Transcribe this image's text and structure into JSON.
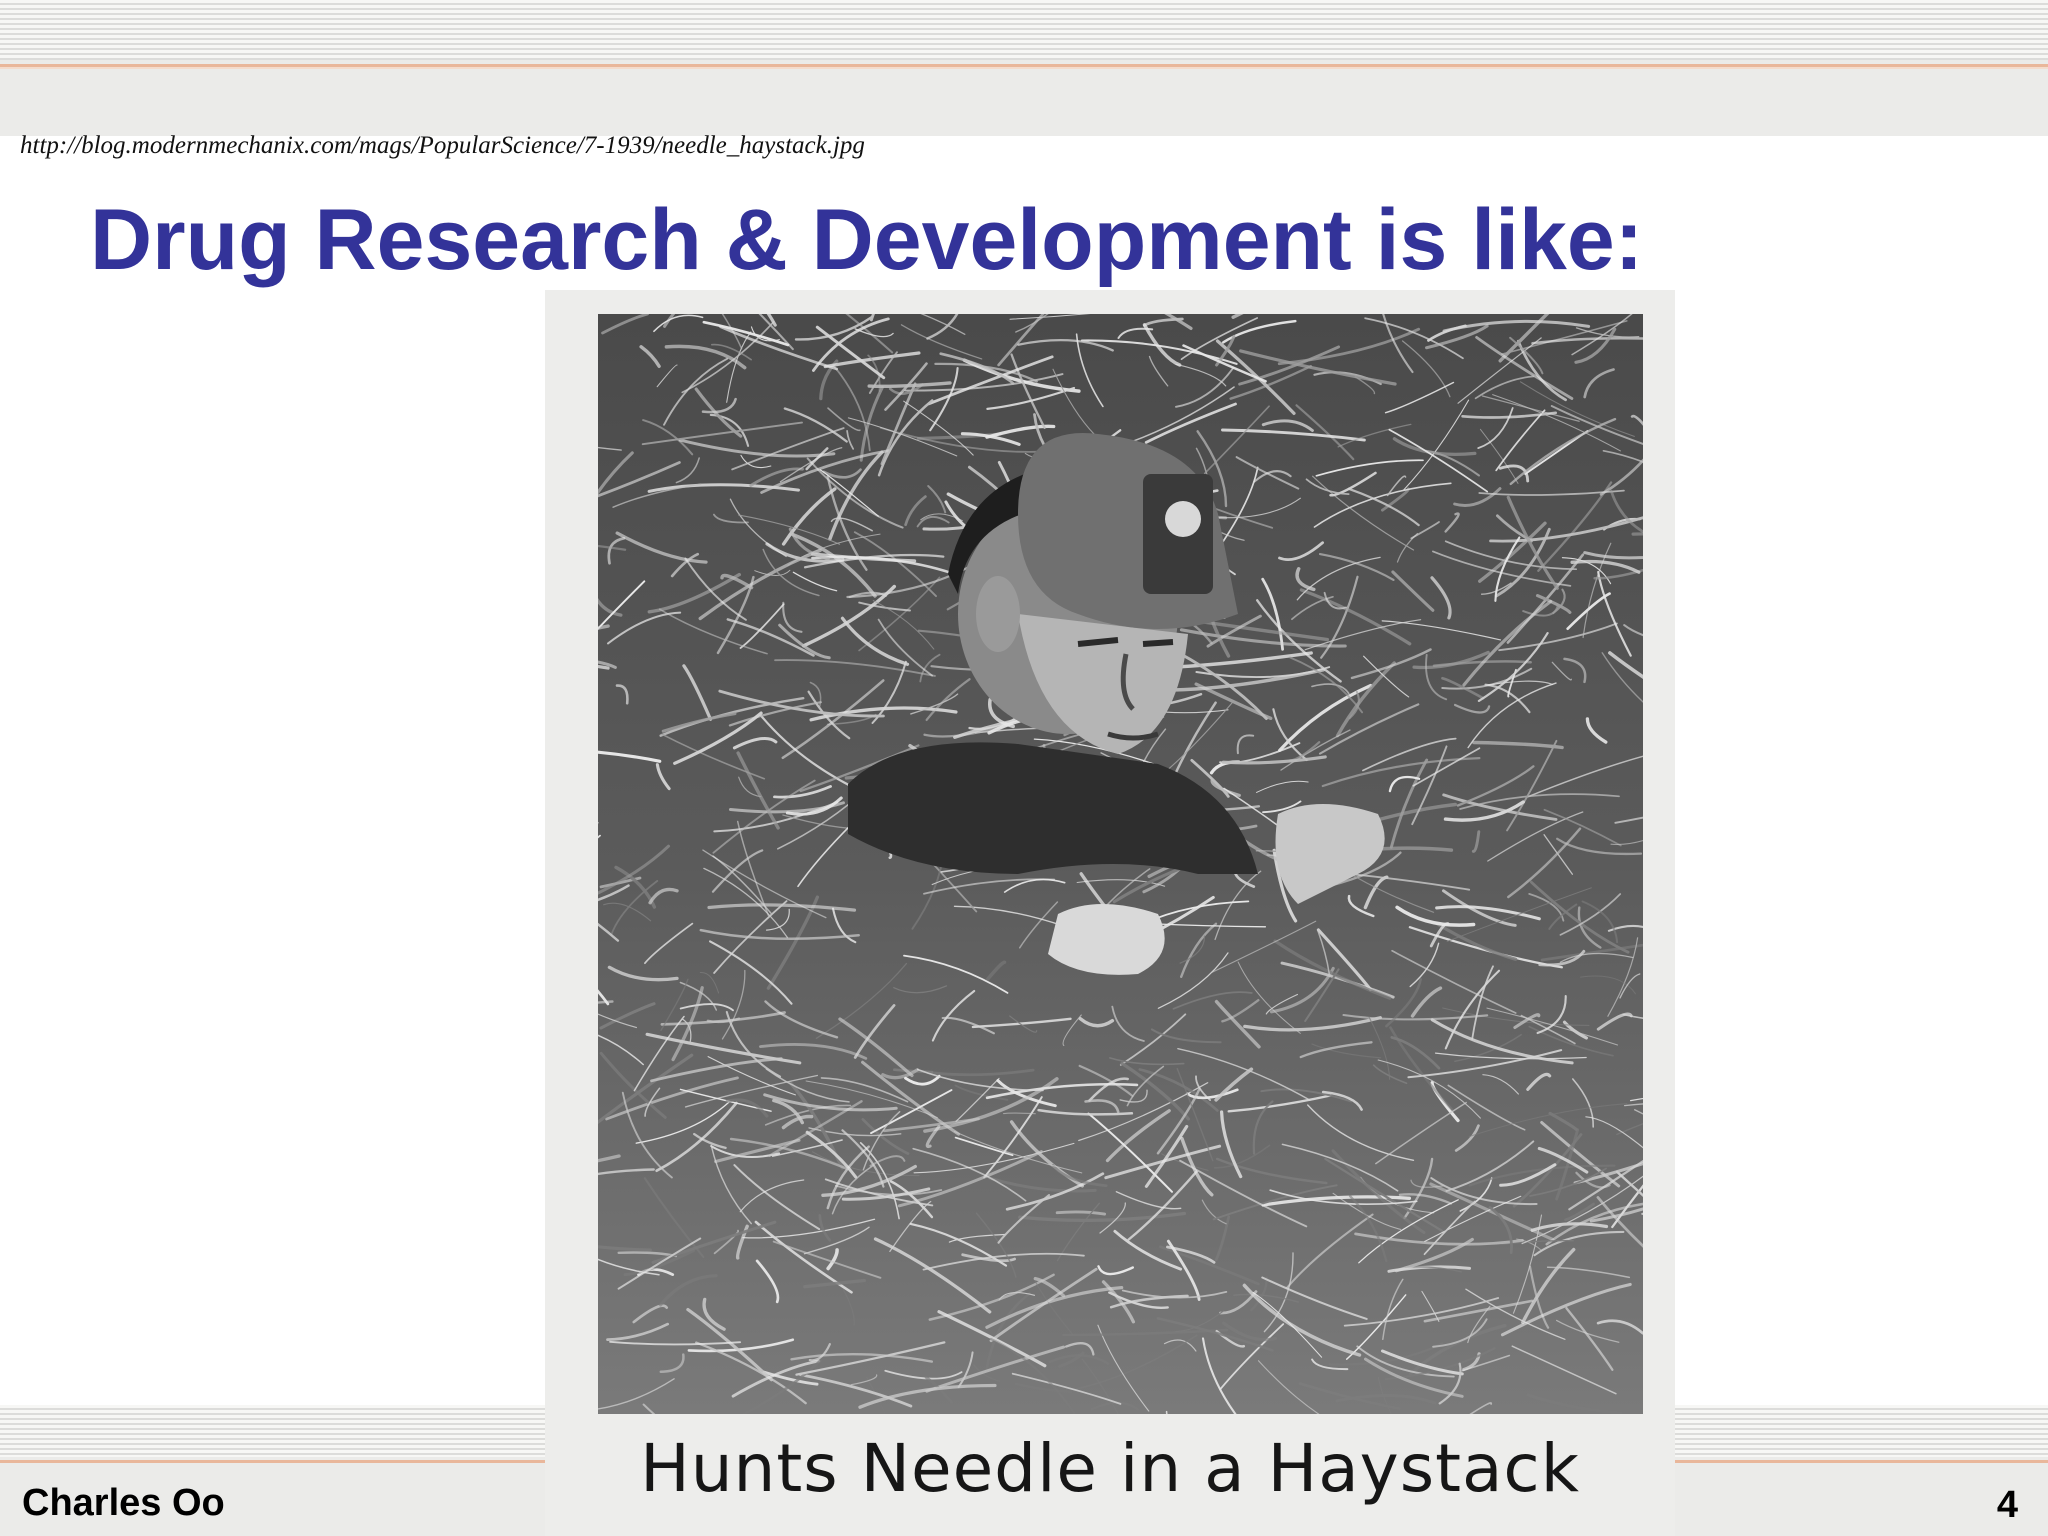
{
  "slide": {
    "source_url": "http://blog.modernmechanix.com/mags/PopularScience/7-1939/needle_haystack.jpg",
    "title": "Drug Research & Development is like:",
    "photo_caption": "Hunts Needle in a Haystack",
    "footer_author": "Charles Oo",
    "slide_number": "4"
  },
  "colors": {
    "title": "#333399",
    "band": "#ebebe9",
    "band_accent": "#e9b79b"
  }
}
